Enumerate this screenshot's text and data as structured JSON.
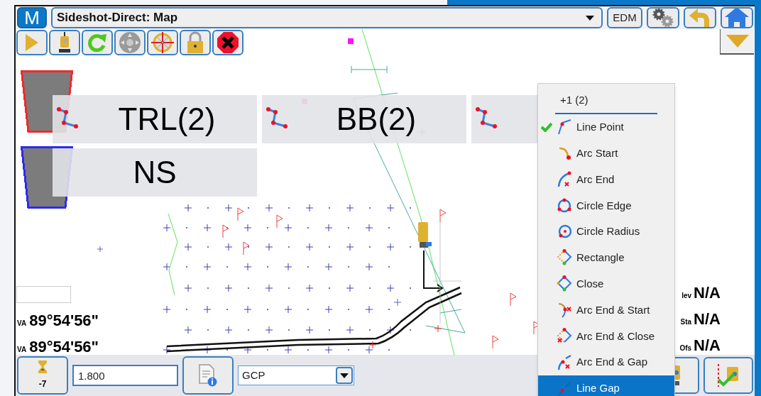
{
  "logo": "M",
  "title": "Sideshot-Direct: Map",
  "header_buttons": [
    {
      "kind": "text",
      "label": "EDM"
    },
    {
      "kind": "gears"
    },
    {
      "kind": "back"
    },
    {
      "kind": "home"
    }
  ],
  "code_rows": [
    {
      "color": "#ee2b2b",
      "codes": [
        {
          "kind": "line",
          "label": "TRL(2)"
        },
        {
          "kind": "line",
          "label": "BB(2)"
        },
        {
          "kind": "line"
        }
      ]
    },
    {
      "color": "#2b2bee",
      "codes": [
        {
          "kind": "plain",
          "label": "NS"
        }
      ]
    }
  ],
  "left_readouts": [
    {
      "label": "VA",
      "value": "89°54'56\""
    },
    {
      "label": "VA",
      "value": "89°54'56\""
    }
  ],
  "right_readouts": [
    {
      "label": "lev",
      "value": "N/A"
    },
    {
      "label": "Sta",
      "value": "N/A"
    },
    {
      "label": "Ofs",
      "value": "N/A"
    }
  ],
  "bottom_bar": {
    "step_label": "-7",
    "height_value": "1.800",
    "code_value": "GCP"
  },
  "menu": {
    "title": "+1 (2)",
    "items": [
      {
        "kind": "linepoint",
        "label": "Line Point",
        "checked": true,
        "selected": false
      },
      {
        "kind": "arcstart",
        "label": "Arc Start",
        "checked": false,
        "selected": false
      },
      {
        "kind": "arcend",
        "label": "Arc End",
        "checked": false,
        "selected": false
      },
      {
        "kind": "circleedge",
        "label": "Circle Edge",
        "checked": false,
        "selected": false
      },
      {
        "kind": "circleradius",
        "label": "Circle Radius",
        "checked": false,
        "selected": false
      },
      {
        "kind": "rectangle",
        "label": "Rectangle",
        "checked": false,
        "selected": false
      },
      {
        "kind": "close",
        "label": "Close",
        "checked": false,
        "selected": false
      },
      {
        "kind": "arcendstart",
        "label": "Arc End & Start",
        "checked": false,
        "selected": false
      },
      {
        "kind": "arcendclose",
        "label": "Arc End & Close",
        "checked": false,
        "selected": false
      },
      {
        "kind": "arcendgap",
        "label": "Arc End & Gap",
        "checked": false,
        "selected": false
      },
      {
        "kind": "linegap",
        "label": "Line Gap",
        "checked": false,
        "selected": true
      }
    ]
  }
}
